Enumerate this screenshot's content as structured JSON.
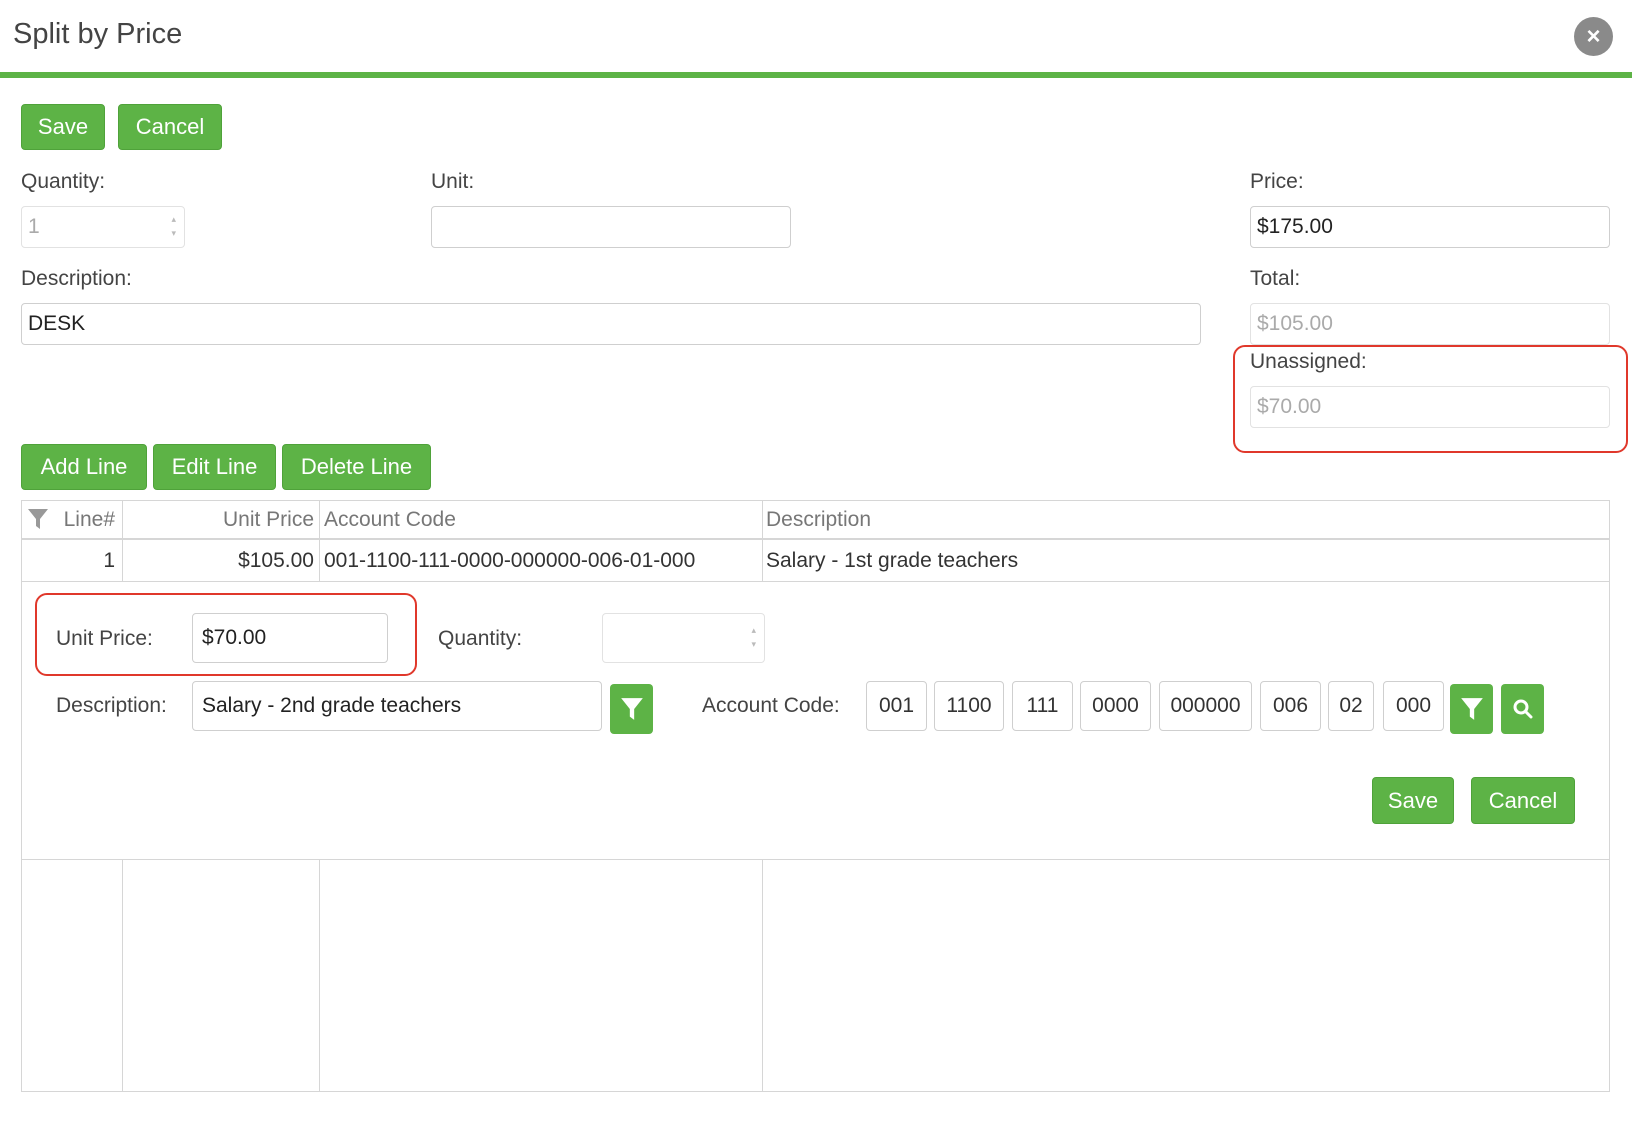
{
  "dialog": {
    "title": "Split by Price",
    "close_icon": "close-icon"
  },
  "toolbar": {
    "save_label": "Save",
    "cancel_label": "Cancel"
  },
  "form": {
    "quantity_label": "Quantity:",
    "quantity_value": "1",
    "unit_label": "Unit:",
    "unit_value": "",
    "price_label": "Price:",
    "price_value": "$175.00",
    "description_label": "Description:",
    "description_value": "DESK",
    "total_label": "Total:",
    "total_value": "$105.00",
    "unassigned_label": "Unassigned:",
    "unassigned_value": "$70.00"
  },
  "line_toolbar": {
    "add_label": "Add Line",
    "edit_label": "Edit Line",
    "delete_label": "Delete Line"
  },
  "grid": {
    "columns": [
      "Line#",
      "Unit Price",
      "Account Code",
      "Description"
    ],
    "rows": [
      {
        "line": "1",
        "unit_price": "$105.00",
        "account_code": "001-1100-111-0000-000000-006-01-000",
        "description": "Salary - 1st grade teachers"
      }
    ]
  },
  "editor": {
    "unit_price_label": "Unit Price:",
    "unit_price_value": "$70.00",
    "quantity_label": "Quantity:",
    "quantity_value": "",
    "description_label": "Description:",
    "description_value": "Salary - 2nd grade teachers",
    "account_code_label": "Account Code:",
    "account_segments": [
      "001",
      "1100",
      "111",
      "0000",
      "000000",
      "006",
      "02",
      "000"
    ],
    "save_label": "Save",
    "cancel_label": "Cancel"
  },
  "colors": {
    "accent": "#5db346",
    "highlight": "#e0382b"
  }
}
